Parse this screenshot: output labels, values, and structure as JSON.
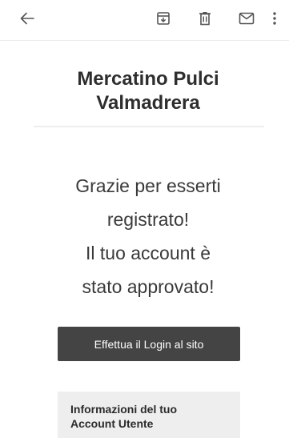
{
  "toolbar": {
    "icons": [
      "back-arrow-icon",
      "archive-icon",
      "delete-icon",
      "mail-icon",
      "more-vertical-icon"
    ]
  },
  "email": {
    "title": "Mercatino Pulci Valmadrera",
    "message": "Grazie per esserti\nregistrato!\nIl tuo account è\nstato approvato!",
    "login_button_label": "Effettua il Login al sito",
    "info_box_title": "Informazioni del tuo Account Utente"
  },
  "colors": {
    "button_bg": "#444444",
    "info_box_bg": "#eeeeee",
    "text": "#2e2e2e"
  }
}
